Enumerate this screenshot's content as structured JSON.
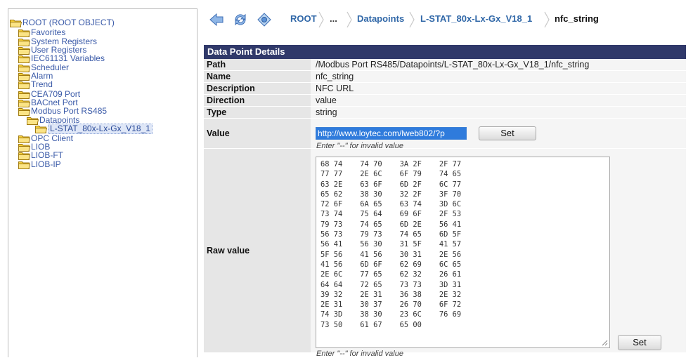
{
  "tree": {
    "root": "ROOT (ROOT OBJECT)",
    "items": [
      {
        "label": "Favorites"
      },
      {
        "label": "System Registers"
      },
      {
        "label": "User Registers"
      },
      {
        "label": "IEC61131 Variables"
      },
      {
        "label": "Scheduler"
      },
      {
        "label": "Alarm"
      },
      {
        "label": "Trend"
      },
      {
        "label": "CEA709 Port"
      },
      {
        "label": "BACnet Port"
      },
      {
        "label": "Modbus Port RS485"
      },
      {
        "label": "Datapoints"
      },
      {
        "label": "L-STAT_80x-Lx-Gx_V18_1"
      },
      {
        "label": "OPC Client"
      },
      {
        "label": "LIOB"
      },
      {
        "label": "LIOB-FT"
      },
      {
        "label": "LIOB-IP"
      }
    ]
  },
  "breadcrumb": [
    "ROOT",
    "...",
    "Datapoints",
    "L-STAT_80x-Lx-Gx_V18_1",
    "nfc_string"
  ],
  "details": {
    "title": "Data Point Details",
    "path_label": "Path",
    "path": "/Modbus Port RS485/Datapoints/L-STAT_80x-Lx-Gx_V18_1/nfc_string",
    "name_label": "Name",
    "name": "nfc_string",
    "description_label": "Description",
    "description": "NFC URL",
    "direction_label": "Direction",
    "direction": "value",
    "type_label": "Type",
    "type": "string",
    "value_label": "Value",
    "value": "http://www.loytec.com/lweb802/?p",
    "set_label": "Set",
    "hint": "Enter \"--\" for invalid value",
    "raw_label": "Raw value",
    "raw": "68 74    74 70    3A 2F    2F 77\n77 77    2E 6C    6F 79    74 65\n63 2E    63 6F    6D 2F    6C 77\n65 62    38 30    32 2F    3F 70\n72 6F    6A 65    63 74    3D 6C\n73 74    75 64    69 6F    2F 53\n79 73    74 65    6D 2E    56 41\n56 73    79 73    74 65    6D 5F\n56 41    56 30    31 5F    41 57\n5F 56    41 56    30 31    2E 56\n41 56    6D 6F    62 69    6C 65\n2E 6C    77 65    62 32    26 61\n64 64    72 65    73 73    3D 31\n39 32    2E 31    36 38    2E 32\n2E 31    30 37    26 70    6F 72\n74 3D    38 30    23 6C    76 69\n73 50    61 67    65 00",
    "raw_set_label": "Set",
    "raw_hint": "Enter \"--\" for invalid value"
  },
  "colors": {
    "header_bg": "#30396a",
    "link": "#3168a8",
    "tree_text": "#3a5aa8",
    "folder": "#f0c419"
  }
}
